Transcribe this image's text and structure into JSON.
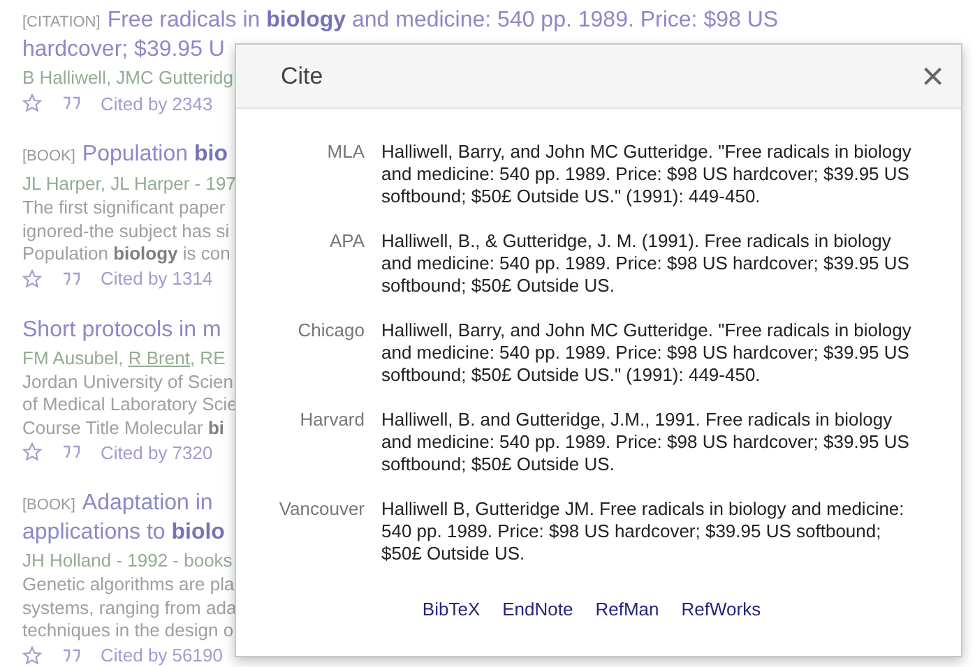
{
  "results": [
    {
      "type_label": "[CITATION]",
      "title_lines": [
        "Free radicals in **biology** and medicine: 540 pp. 1989. Price: $98 US",
        "hardcover; $39.95 U"
      ],
      "authors": [
        {
          "text": "B Halliwell, JMC Gutteridg",
          "linked": false
        }
      ],
      "actions": [
        "Cited by 2343"
      ]
    },
    {
      "type_label": "[BOOK]",
      "title_lines": [
        "Population **bio**"
      ],
      "authors": [
        {
          "text": "JL Harper, JL Harper - 197",
          "linked": false
        }
      ],
      "snippet": [
        "The first significant paper",
        "ignored-the subject has si",
        "Population **biology** is con"
      ],
      "actions": [
        "Cited by 1314"
      ]
    },
    {
      "title_lines": [
        "Short protocols in m"
      ],
      "authors": [
        {
          "text": "FM Ausubel, ",
          "linked": false
        },
        {
          "text": "R Brent",
          "linked": true
        },
        {
          "text": ", RE",
          "linked": false
        }
      ],
      "snippet": [
        "Jordan University of Scien",
        "of Medical Laboratory Scie",
        "Course Title Molecular **bi**"
      ],
      "actions": [
        "Cited by 7320"
      ]
    },
    {
      "type_label": "[BOOK]",
      "title_lines": [
        "Adaptation in",
        "applications to **biolo**"
      ],
      "authors": [
        {
          "text": "JH Holland - 1992 - books",
          "linked": false
        }
      ],
      "snippet": [
        "Genetic algorithms are pla",
        "systems, ranging from ada",
        "techniques in the design o"
      ],
      "actions": [
        "Cited by 56190"
      ]
    }
  ],
  "dialog": {
    "title": "Cite",
    "close": "×",
    "citations": [
      {
        "style": "MLA",
        "text": "Halliwell, Barry, and John MC Gutteridge. \"Free radicals in biology and medicine: 540 pp. 1989. Price: $98 US hardcover; $39.95 US softbound; $50£ Outside US.\" (1991): 449-450."
      },
      {
        "style": "APA",
        "text": "Halliwell, B., & Gutteridge, J. M. (1991). Free radicals in biology and medicine: 540 pp. 1989. Price: $98 US hardcover; $39.95 US softbound; $50£ Outside US."
      },
      {
        "style": "Chicago",
        "text": "Halliwell, Barry, and John MC Gutteridge. \"Free radicals in biology and medicine: 540 pp. 1989. Price: $98 US hardcover; $39.95 US softbound; $50£ Outside US.\" (1991): 449-450."
      },
      {
        "style": "Harvard",
        "text": "Halliwell, B. and Gutteridge, J.M., 1991. Free radicals in biology and medicine: 540 pp. 1989. Price: $98 US hardcover; $39.95 US softbound; $50£ Outside US."
      },
      {
        "style": "Vancouver",
        "text": "Halliwell B, Gutteridge JM. Free radicals in biology and medicine: 540 pp. 1989. Price: $98 US hardcover; $39.95 US softbound; $50£ Outside US."
      }
    ],
    "exports": [
      "BibTeX",
      "EndNote",
      "RefMan",
      "RefWorks"
    ]
  }
}
